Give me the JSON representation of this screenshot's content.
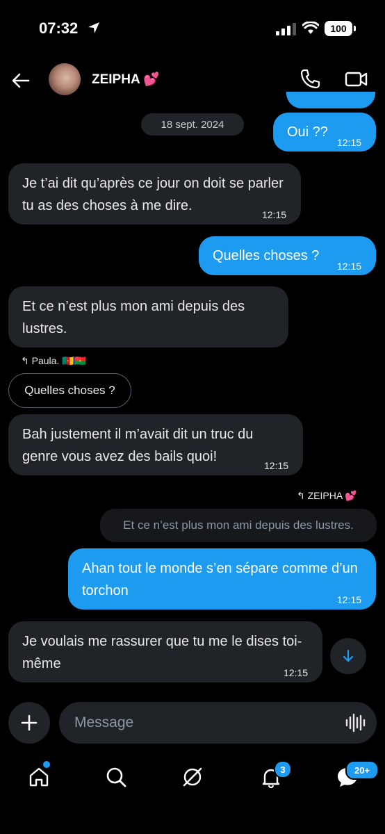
{
  "status_bar": {
    "time": "07:32",
    "battery": "100"
  },
  "header": {
    "contact_name": "ZEIPHA 💕"
  },
  "date_separator": "18 sept. 2024",
  "messages": [
    {
      "direction": "out",
      "text": "Oui ??",
      "time": "12:15"
    },
    {
      "direction": "in",
      "text": "Je t’ai dit qu’après ce jour on doit se parler tu as des choses à me dire.",
      "time": "12:15"
    },
    {
      "direction": "out",
      "text": "Quelles choses ?",
      "time": "12:15"
    },
    {
      "direction": "in",
      "text": "Et ce n’est plus mon ami depuis des lustres."
    },
    {
      "direction": "in",
      "reply_to": "Paula. 🇨🇲🇧🇫",
      "quoted": "Quelles choses ?",
      "text": "Bah justement il m’avait dit un truc du genre vous avez des bails quoi!",
      "time": "12:15"
    },
    {
      "direction": "out",
      "reply_to": "ZEIPHA 💕",
      "quoted": "Et ce n’est plus mon ami depuis des lustres.",
      "text": "Ahan tout le monde s’en sépare comme d’un torchon",
      "time": "12:15"
    },
    {
      "direction": "in",
      "text": "Je voulais me rassurer que tu me le dises toi-même",
      "time": "12:15"
    }
  ],
  "composer": {
    "placeholder": "Message"
  },
  "bottom_nav": {
    "items": [
      "home-icon",
      "search-icon",
      "grok-icon",
      "notifications-icon",
      "messages-icon"
    ],
    "notifications_badge": "3",
    "messages_badge": "20+"
  },
  "colors": {
    "accent": "#1d9bf0",
    "incoming_bubble": "#202327",
    "background": "#000000"
  }
}
